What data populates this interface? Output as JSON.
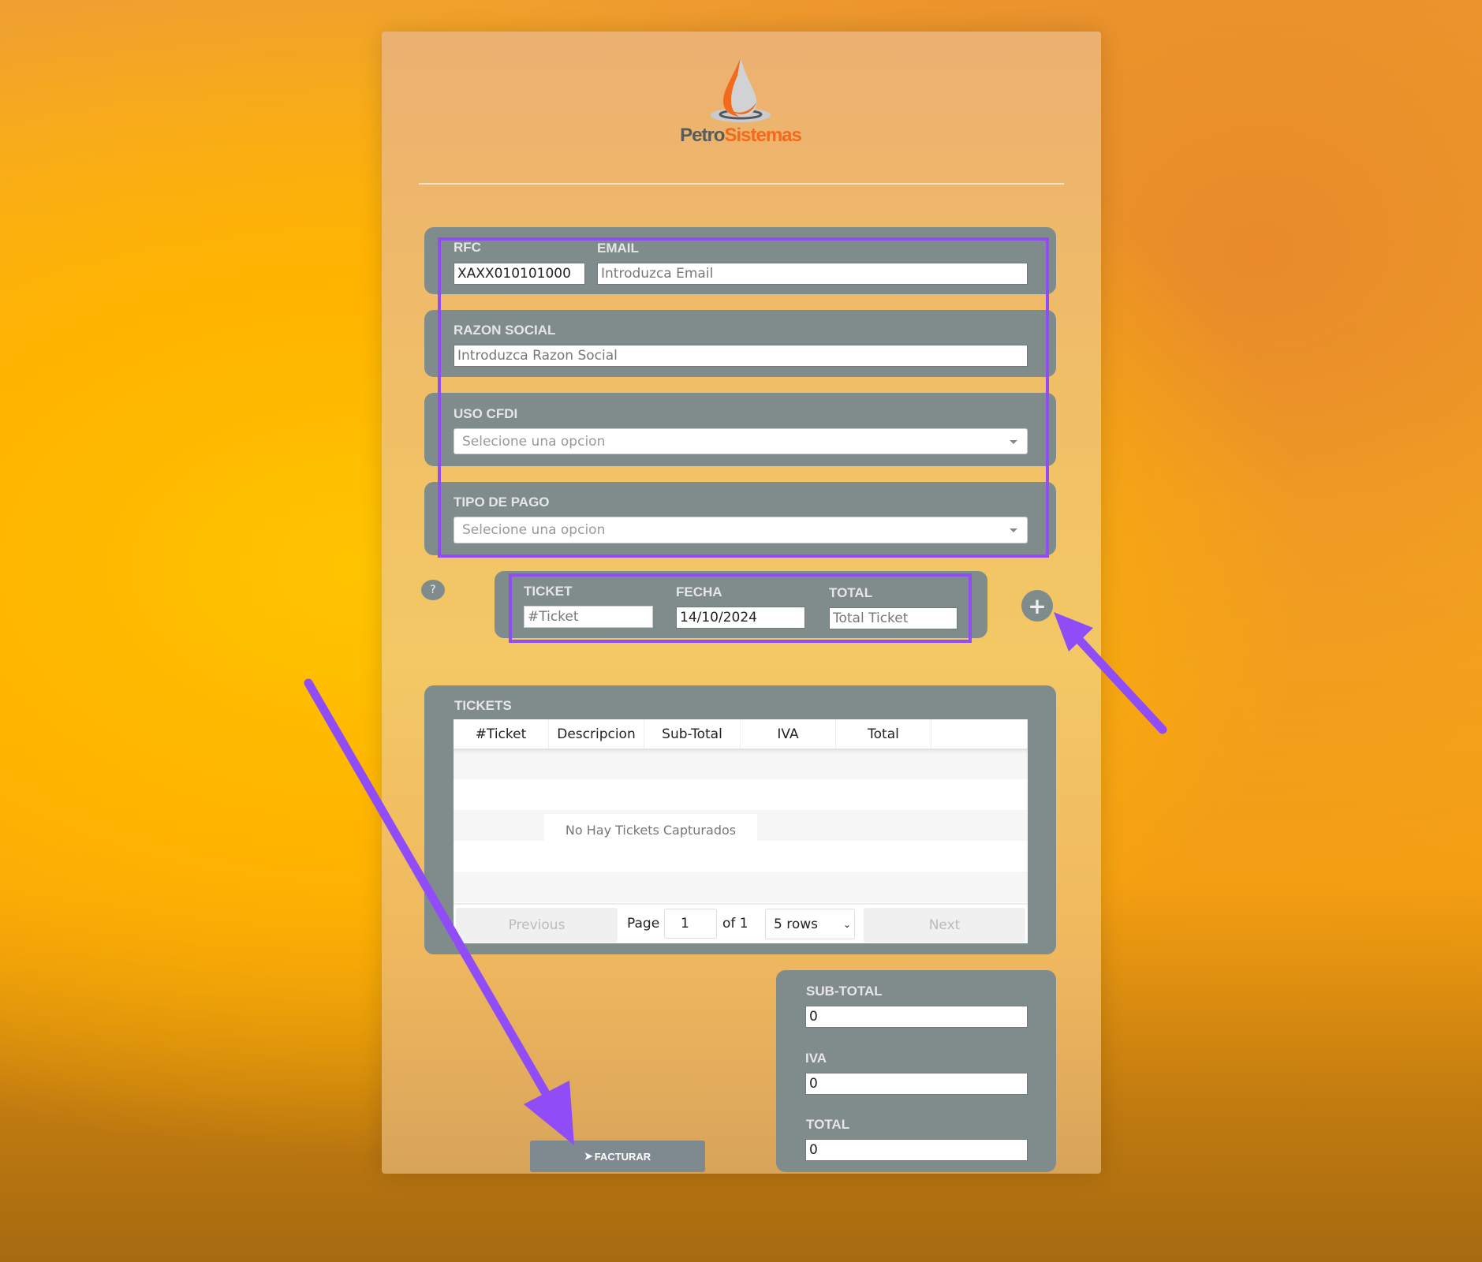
{
  "brand": {
    "name_part1": "Petro",
    "name_part2": "Sistemas",
    "colors": {
      "gray": "#5a5a5a",
      "orange": "#f26a1b"
    }
  },
  "form": {
    "rfc": {
      "label": "RFC",
      "value": "XAXX010101000"
    },
    "email": {
      "label": "EMAIL",
      "placeholder": "Introduzca Email"
    },
    "razon_social": {
      "label": "RAZON SOCIAL",
      "placeholder": "Introduzca Razon Social"
    },
    "uso_cfdi": {
      "label": "USO CFDI",
      "selected": "Selecione una opcion"
    },
    "tipo_pago": {
      "label": "TIPO DE PAGO",
      "selected": "Selecione una opcion"
    }
  },
  "ticket_entry": {
    "help_label": "?",
    "ticket": {
      "label": "TICKET",
      "placeholder": "#Ticket"
    },
    "fecha": {
      "label": "FECHA",
      "value": "14/10/2024"
    },
    "total": {
      "label": "TOTAL",
      "placeholder": "Total Ticket"
    },
    "add_icon": "plus-icon"
  },
  "tickets": {
    "title": "TICKETS",
    "columns": [
      "#Ticket",
      "Descripcion",
      "Sub-Total",
      "IVA",
      "Total",
      ""
    ],
    "empty_text": "No Hay Tickets Capturados",
    "pagination": {
      "previous": "Previous",
      "page_label": "Page",
      "page": "1",
      "of_label": "of 1",
      "rows": "5 rows",
      "next": "Next"
    }
  },
  "summary": {
    "subtotal": {
      "label": "SUB-TOTAL",
      "value": "0"
    },
    "iva": {
      "label": "IVA",
      "value": "0"
    },
    "total": {
      "label": "TOTAL",
      "value": "0"
    }
  },
  "facturar_button": "FACTURAR",
  "annotation_color": "#8f4cf7"
}
